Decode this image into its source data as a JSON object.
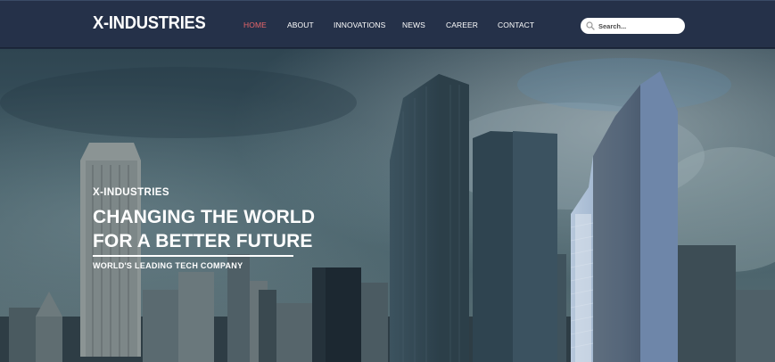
{
  "header": {
    "brand": "X-INDUSTRIES",
    "menu": [
      {
        "label": "HOME",
        "active": true
      },
      {
        "label": "ABOUT",
        "active": false
      },
      {
        "label": "INNOVATIONS",
        "active": false
      },
      {
        "label": "NEWS",
        "active": false
      },
      {
        "label": "CAREER",
        "active": false
      },
      {
        "label": "CONTACT",
        "active": false
      }
    ],
    "search": {
      "placeholder": "Search..."
    }
  },
  "hero": {
    "eyebrow": "X-INDUSTRIES",
    "headline_line1": "CHANGING THE WORLD",
    "headline_line2": "FOR A BETTER FUTURE",
    "tagline": "WORLD'S LEADING TECH COMPANY"
  },
  "colors": {
    "nav_background": "#253149",
    "active_link": "#e8666a",
    "text": "#ffffff"
  }
}
